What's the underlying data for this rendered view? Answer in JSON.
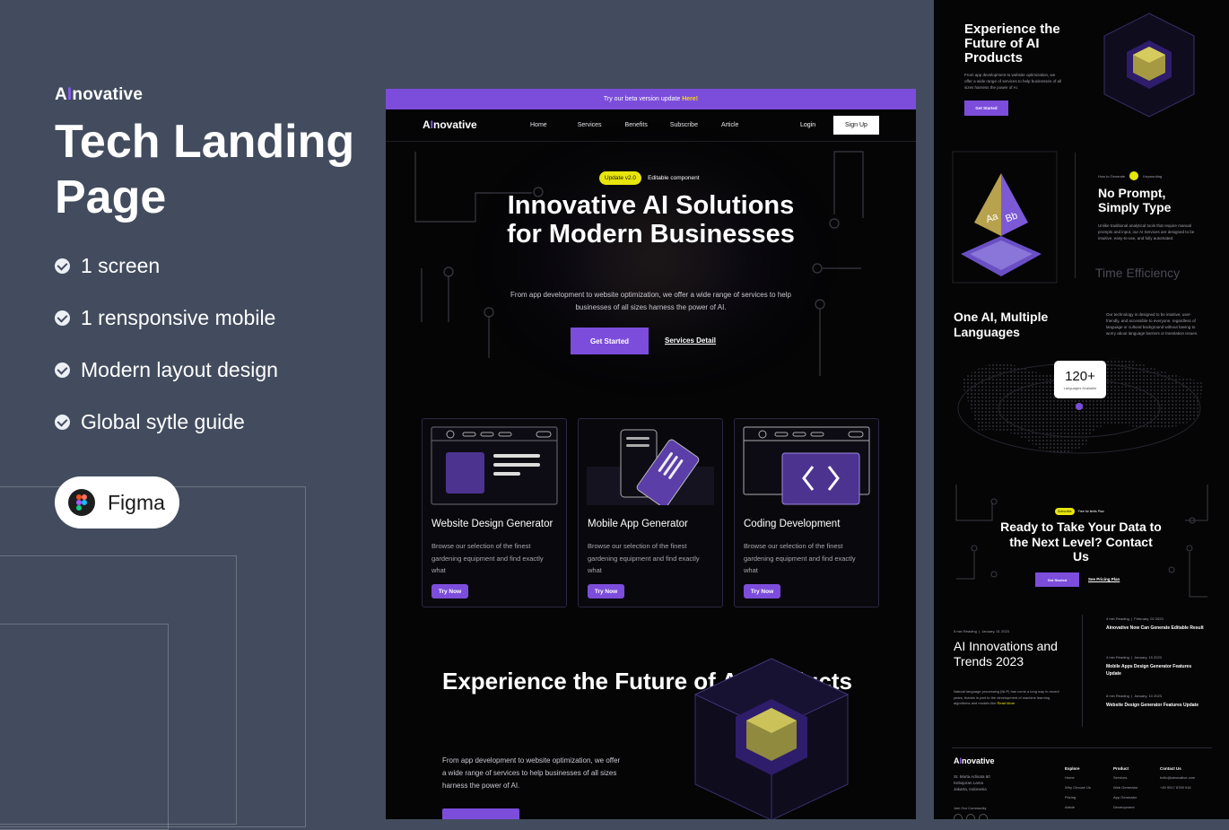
{
  "left_panel": {
    "brand": {
      "prefix": "A",
      "ai": "I",
      "rest": "novative"
    },
    "title": "Tech Landing Page",
    "features": [
      "1 screen",
      "1 rensponsive mobile",
      "Modern layout design",
      "Global sytle guide"
    ],
    "figma_label": "Figma"
  },
  "desktop": {
    "beta_text": "Try our beta version update ",
    "beta_link": "Here!",
    "logo": "Ainovative",
    "nav_links": [
      "Home",
      "Services",
      "Benefits",
      "Subscribe",
      "Article"
    ],
    "login": "Login",
    "signup": "Sign Up",
    "hero": {
      "badge": "Update v2.0",
      "badge_text": "Editable component",
      "title": "Innovative AI Solutions for Modern Businesses",
      "subtitle": "From app development to website optimization, we offer a wide range of services to help businesses of all sizes harness the power of AI.",
      "cta": "Get Started",
      "secondary": "Services Detail"
    },
    "cards": [
      {
        "title": "Website Design Generator",
        "desc": "Browse our selection of the finest gardening equipment and find exactly what",
        "cta": "Try Now"
      },
      {
        "title": "Mobile App Generator",
        "desc": "Browse our selection of the finest gardening equipment and find exactly what",
        "cta": "Try Now"
      },
      {
        "title": "Coding Development",
        "desc": "Browse our selection of the finest gardening equipment and find exactly what",
        "cta": "Try Now"
      }
    ],
    "experience": {
      "title": "Experience the Future of AI Products",
      "subtitle": "From app development to website optimization, we offer a wide range of services to help businesses of all sizes harness the power of AI."
    }
  },
  "mobile": {
    "experience": {
      "title": "Experience the Future of AI Products",
      "subtitle": "From app development to website optimization, we offer a wide range of services to help businesses of all sizes harness the power of AI.",
      "cta": "Get Started"
    },
    "prompt": {
      "step1": "How to Generate",
      "step2": "Keywording",
      "title": "No Prompt, Simply Type",
      "desc": "Unlike traditional analytical tools that require manual prompts and input, our AI Services are designed to be intuitive, easy-to-use, and fully automated.",
      "faded": "Time Efficiency"
    },
    "languages": {
      "title": "One AI, Multiple Languages",
      "desc": "Our technology is designed to be intuitive, user-friendly, and accessible to everyone, regardless of language or cultural background without having to worry about language barriers or translation issues.",
      "stat": "120+",
      "stat_label": "Languages Available"
    },
    "cta_section": {
      "badge": "Subscribe",
      "badge_text": "Free for limits Plan",
      "title": "Ready to Take Your Data to the Next Level? Contact Us",
      "cta": "Get Started",
      "link": "See Pricing Plan"
    },
    "articles": {
      "main_meta": "5 min Reading",
      "main_date": "January, 01 2023",
      "main_title": "AI Innovations and Trends 2023",
      "main_desc": "Natural language processing (NLP) has come a long way in recent years, thanks in part to the development of machine learning algorithms and models like ",
      "read_more": "Read More",
      "list": [
        {
          "meta": "4 min Reading",
          "date": "February, 02 2023",
          "title": "Ainovative Now Can Generate Editable Result"
        },
        {
          "meta": "4 min Reading",
          "date": "January, 15 2023",
          "title": "Mobile Apps Design Generator Features Update"
        },
        {
          "meta": "8 min Reading",
          "date": "January, 10 2023",
          "title": "Website Design Generator Features Update"
        }
      ]
    },
    "footer": {
      "logo": "Ainovative",
      "address": [
        "St. Marta Adinata 60",
        "Kebajoran Lama",
        "Jakarta, Indonesia"
      ],
      "community": "Join Our Community",
      "cols": [
        {
          "head": "Explore",
          "items": [
            "Home",
            "Why Choose Us",
            "Pricing",
            "Article"
          ]
        },
        {
          "head": "Product",
          "items": [
            "Services",
            "Web Generator",
            "App Generator",
            "Development"
          ]
        },
        {
          "head": "Contact Us",
          "items": [
            "hello@ainovative.com",
            "+49 9917 8789 916"
          ]
        }
      ]
    }
  },
  "colors": {
    "accent": "#7c4ddb",
    "yellow": "#e7e50c",
    "panel": "#434c5e"
  }
}
